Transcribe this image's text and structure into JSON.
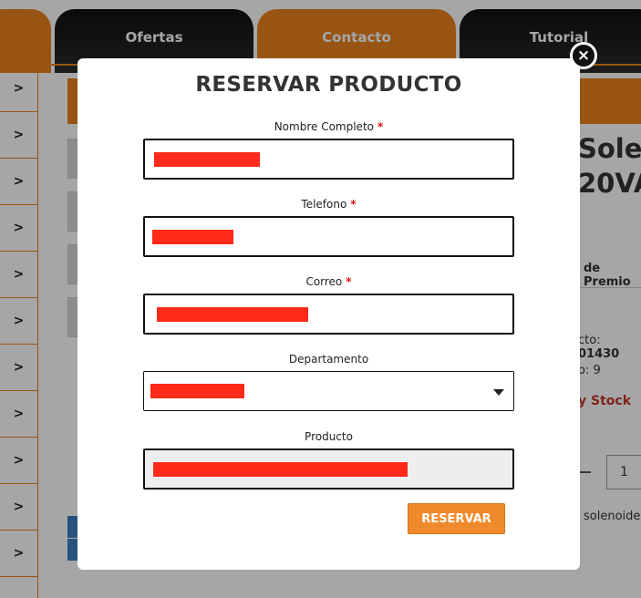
{
  "nav": {
    "tabs": [
      {
        "label": "Ofertas"
      },
      {
        "label": "Contacto"
      },
      {
        "label": "Tutorial"
      }
    ]
  },
  "sidebar": {
    "chevron": ">",
    "items": 11
  },
  "background": {
    "product_title_line1": "Sole",
    "product_title_line2": "20VA",
    "premio_label": "de Premio",
    "codigo_label": "cto:",
    "codigo_value": "01430",
    "stock_count_label": "o: 9",
    "stock_label": "y Stock",
    "quantity": "1",
    "desc_snippet": "solenoide,"
  },
  "modal": {
    "title": "RESERVAR PRODUCTO",
    "close_glyph": "×",
    "fields": {
      "nombre": {
        "label": "Nombre Completo",
        "required_mark": "*"
      },
      "telefono": {
        "label": "Telefono",
        "required_mark": "*"
      },
      "correo": {
        "label": "Correo",
        "required_mark": "*"
      },
      "departamento": {
        "label": "Departamento"
      },
      "producto": {
        "label": "Producto"
      }
    },
    "submit_label": "RESERVAR"
  },
  "colors": {
    "accent": "#e8821e",
    "button": "#ef8a2c",
    "required": "#d11",
    "redaction": "#ff2a1a"
  }
}
